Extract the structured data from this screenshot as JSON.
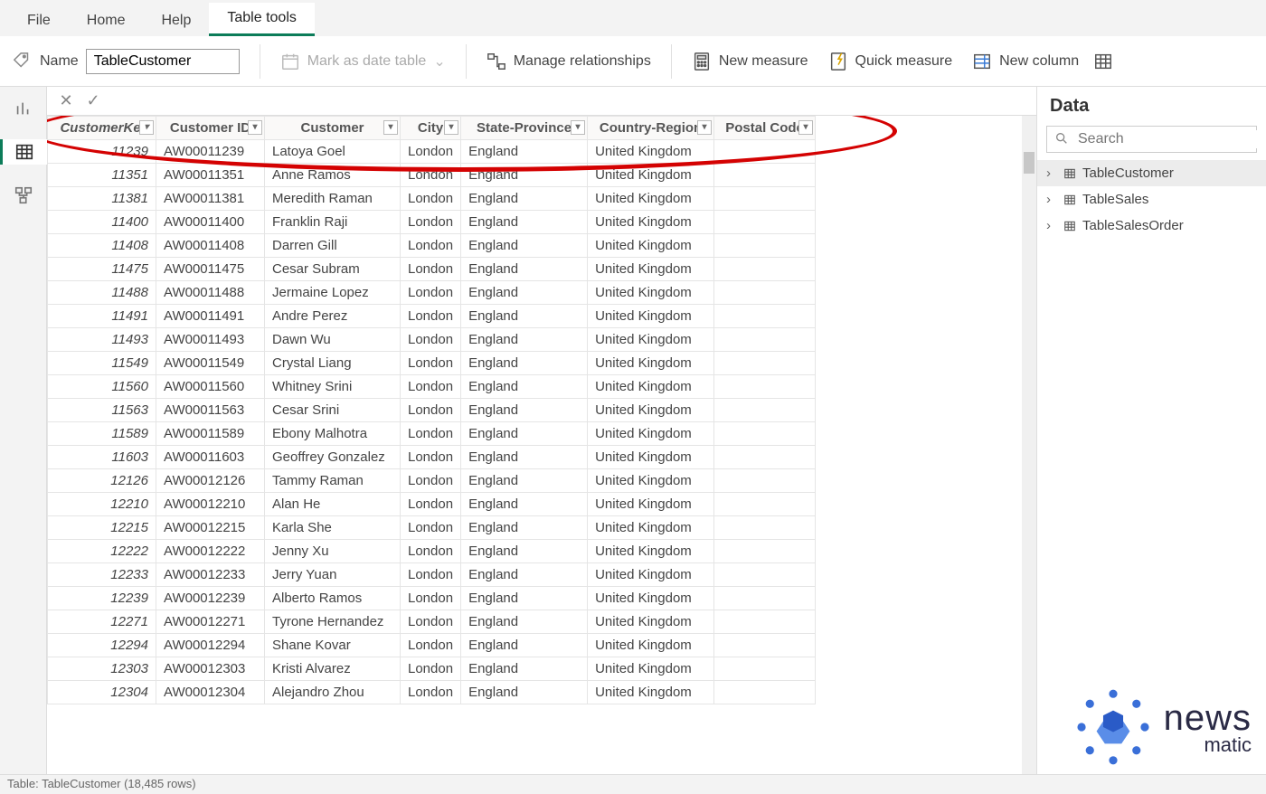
{
  "tabs": {
    "file": "File",
    "home": "Home",
    "help": "Help",
    "tabletools": "Table tools"
  },
  "ribbon": {
    "name_label": "Name",
    "name_value": "TableCustomer",
    "mark_date": "Mark as date table",
    "manage_rel": "Manage relationships",
    "new_measure": "New measure",
    "quick_measure": "Quick measure",
    "new_column": "New column"
  },
  "columns": [
    "CustomerKey",
    "Customer ID",
    "Customer",
    "City",
    "State-Province",
    "Country-Region",
    "Postal Code"
  ],
  "rows": [
    {
      "key": "11239",
      "id": "AW00011239",
      "cust": "Latoya Goel",
      "city": "London",
      "sp": "England",
      "cr": "United Kingdom",
      "pc": ""
    },
    {
      "key": "11351",
      "id": "AW00011351",
      "cust": "Anne Ramos",
      "city": "London",
      "sp": "England",
      "cr": "United Kingdom",
      "pc": ""
    },
    {
      "key": "11381",
      "id": "AW00011381",
      "cust": "Meredith Raman",
      "city": "London",
      "sp": "England",
      "cr": "United Kingdom",
      "pc": ""
    },
    {
      "key": "11400",
      "id": "AW00011400",
      "cust": "Franklin Raji",
      "city": "London",
      "sp": "England",
      "cr": "United Kingdom",
      "pc": ""
    },
    {
      "key": "11408",
      "id": "AW00011408",
      "cust": "Darren Gill",
      "city": "London",
      "sp": "England",
      "cr": "United Kingdom",
      "pc": ""
    },
    {
      "key": "11475",
      "id": "AW00011475",
      "cust": "Cesar Subram",
      "city": "London",
      "sp": "England",
      "cr": "United Kingdom",
      "pc": ""
    },
    {
      "key": "11488",
      "id": "AW00011488",
      "cust": "Jermaine Lopez",
      "city": "London",
      "sp": "England",
      "cr": "United Kingdom",
      "pc": ""
    },
    {
      "key": "11491",
      "id": "AW00011491",
      "cust": "Andre Perez",
      "city": "London",
      "sp": "England",
      "cr": "United Kingdom",
      "pc": ""
    },
    {
      "key": "11493",
      "id": "AW00011493",
      "cust": "Dawn Wu",
      "city": "London",
      "sp": "England",
      "cr": "United Kingdom",
      "pc": ""
    },
    {
      "key": "11549",
      "id": "AW00011549",
      "cust": "Crystal Liang",
      "city": "London",
      "sp": "England",
      "cr": "United Kingdom",
      "pc": ""
    },
    {
      "key": "11560",
      "id": "AW00011560",
      "cust": "Whitney Srini",
      "city": "London",
      "sp": "England",
      "cr": "United Kingdom",
      "pc": ""
    },
    {
      "key": "11563",
      "id": "AW00011563",
      "cust": "Cesar Srini",
      "city": "London",
      "sp": "England",
      "cr": "United Kingdom",
      "pc": ""
    },
    {
      "key": "11589",
      "id": "AW00011589",
      "cust": "Ebony Malhotra",
      "city": "London",
      "sp": "England",
      "cr": "United Kingdom",
      "pc": ""
    },
    {
      "key": "11603",
      "id": "AW00011603",
      "cust": "Geoffrey Gonzalez",
      "city": "London",
      "sp": "England",
      "cr": "United Kingdom",
      "pc": ""
    },
    {
      "key": "12126",
      "id": "AW00012126",
      "cust": "Tammy Raman",
      "city": "London",
      "sp": "England",
      "cr": "United Kingdom",
      "pc": ""
    },
    {
      "key": "12210",
      "id": "AW00012210",
      "cust": "Alan He",
      "city": "London",
      "sp": "England",
      "cr": "United Kingdom",
      "pc": ""
    },
    {
      "key": "12215",
      "id": "AW00012215",
      "cust": "Karla She",
      "city": "London",
      "sp": "England",
      "cr": "United Kingdom",
      "pc": ""
    },
    {
      "key": "12222",
      "id": "AW00012222",
      "cust": "Jenny Xu",
      "city": "London",
      "sp": "England",
      "cr": "United Kingdom",
      "pc": ""
    },
    {
      "key": "12233",
      "id": "AW00012233",
      "cust": "Jerry Yuan",
      "city": "London",
      "sp": "England",
      "cr": "United Kingdom",
      "pc": ""
    },
    {
      "key": "12239",
      "id": "AW00012239",
      "cust": "Alberto Ramos",
      "city": "London",
      "sp": "England",
      "cr": "United Kingdom",
      "pc": ""
    },
    {
      "key": "12271",
      "id": "AW00012271",
      "cust": "Tyrone Hernandez",
      "city": "London",
      "sp": "England",
      "cr": "United Kingdom",
      "pc": ""
    },
    {
      "key": "12294",
      "id": "AW00012294",
      "cust": "Shane Kovar",
      "city": "London",
      "sp": "England",
      "cr": "United Kingdom",
      "pc": ""
    },
    {
      "key": "12303",
      "id": "AW00012303",
      "cust": "Kristi Alvarez",
      "city": "London",
      "sp": "England",
      "cr": "United Kingdom",
      "pc": ""
    },
    {
      "key": "12304",
      "id": "AW00012304",
      "cust": "Alejandro Zhou",
      "city": "London",
      "sp": "England",
      "cr": "United Kingdom",
      "pc": ""
    }
  ],
  "datapane": {
    "title": "Data",
    "search_placeholder": "Search",
    "tables": [
      "TableCustomer",
      "TableSales",
      "TableSalesOrder"
    ]
  },
  "status": "Table: TableCustomer (18,485 rows)",
  "watermark": {
    "line1": "news",
    "line2": "matic"
  }
}
